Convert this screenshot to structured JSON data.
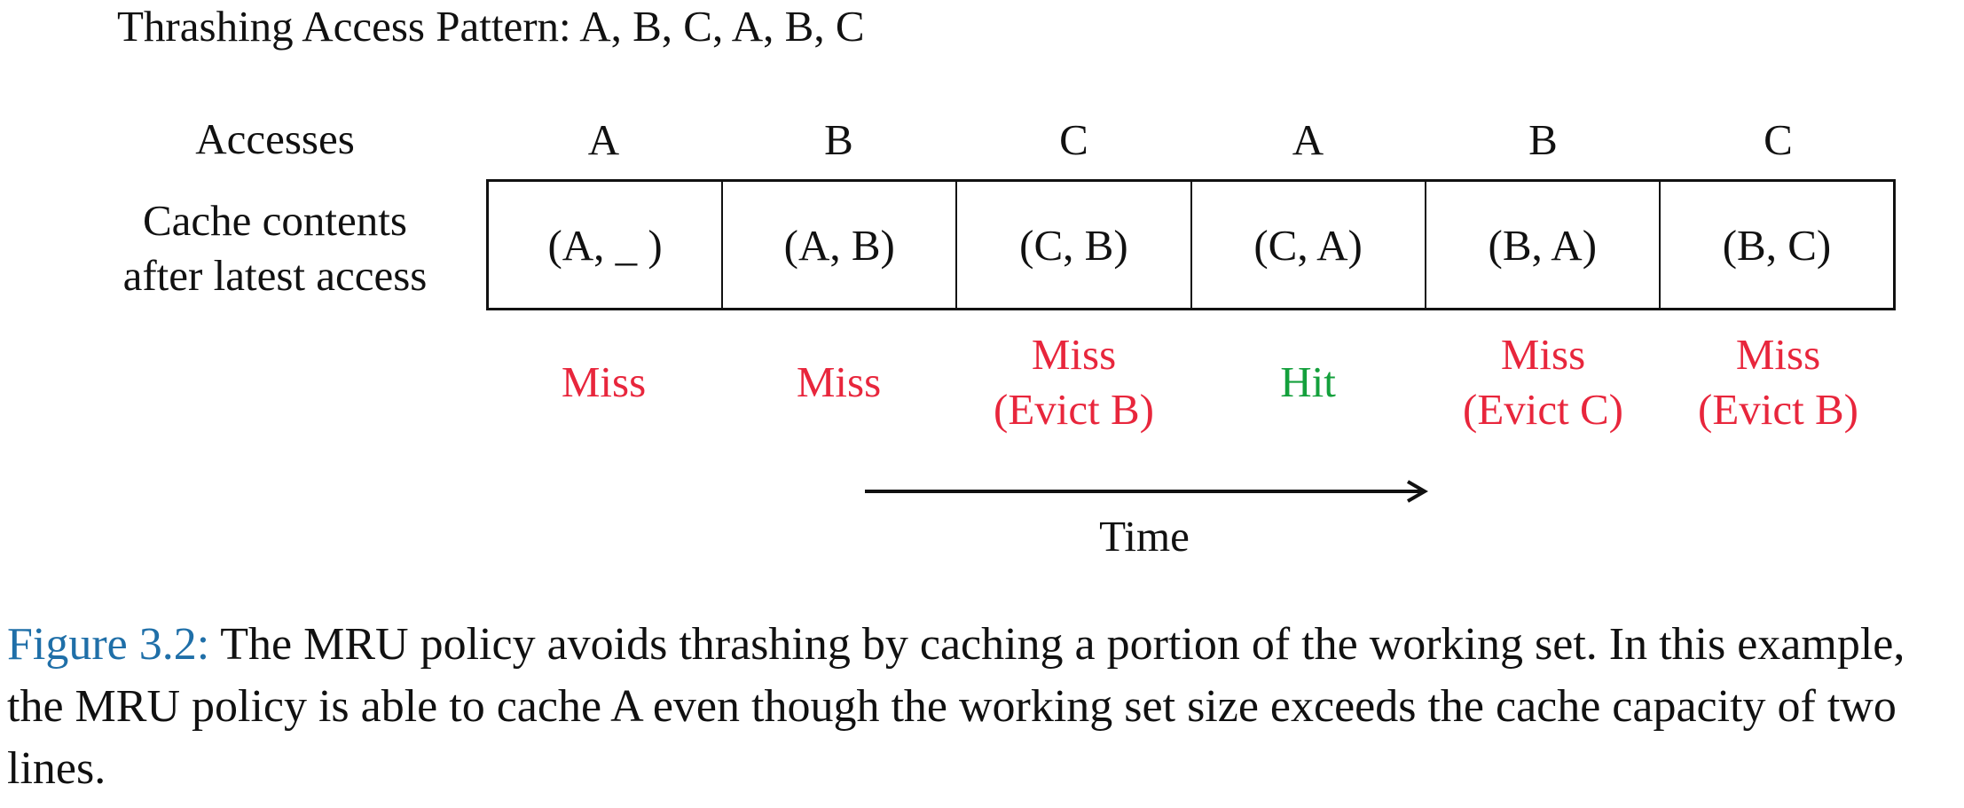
{
  "title": "Thrashing Access Pattern: A, B, C, A, B, C",
  "row_labels": {
    "accesses": "Accesses",
    "cache_contents_line1": "Cache contents",
    "cache_contents_line2": "after latest access"
  },
  "steps": [
    {
      "access": "A",
      "cache": "(A, _ )",
      "result_line1": "Miss",
      "result_line2": "",
      "status": "miss"
    },
    {
      "access": "B",
      "cache": "(A, B)",
      "result_line1": "Miss",
      "result_line2": "",
      "status": "miss"
    },
    {
      "access": "C",
      "cache": "(C, B)",
      "result_line1": "Miss",
      "result_line2": "(Evict B)",
      "status": "miss"
    },
    {
      "access": "A",
      "cache": "(C, A)",
      "result_line1": "Hit",
      "result_line2": "",
      "status": "hit"
    },
    {
      "access": "B",
      "cache": "(B, A)",
      "result_line1": "Miss",
      "result_line2": "(Evict C)",
      "status": "miss"
    },
    {
      "access": "C",
      "cache": "(B, C)",
      "result_line1": "Miss",
      "result_line2": "(Evict B)",
      "status": "miss"
    }
  ],
  "time_label": "Time",
  "caption": {
    "lead": "Figure 3.2:",
    "text": " The MRU policy avoids thrashing by caching a portion of the working set. In this example, the MRU policy is able to cache A even though the working set size exceeds the cache capacity of two lines."
  },
  "colors": {
    "miss": "#e8263c",
    "hit": "#14a03c",
    "caption_lead": "#1f6fa8"
  }
}
